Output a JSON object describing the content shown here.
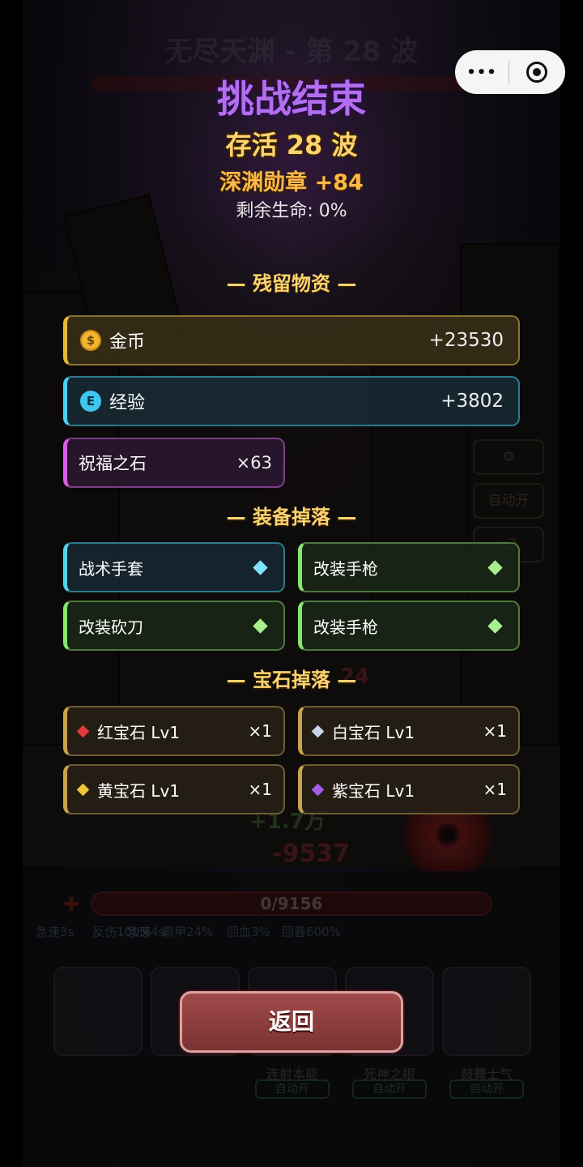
{
  "colors": {
    "title": "#b36ef0",
    "waves": "#ffd36e",
    "medal": "#ffb84a",
    "gold_accent": "#e7b737",
    "exp_accent": "#46d2ee",
    "stone_accent": "#d65ee6",
    "equip_blue_accent": "#53d3ee",
    "equip_green_accent": "#86e56a",
    "gem_accent": "#c9a24d",
    "return_button": "#8e3c3c"
  },
  "background": {
    "stage_title": "无尽天渊 - 第 28 波",
    "hp_bar_text": "0/9156",
    "floating_numbers": [
      "+1.7万",
      "-9537",
      "24"
    ],
    "status_effects": [
      "急速3s",
      "反伤100%",
      "急速4s",
      "霸甲24%",
      "回血3%",
      "回春600%"
    ],
    "skills": [
      {
        "name": "连射本能",
        "auto": "自动开"
      },
      {
        "name": "死神之眼",
        "auto": "自动开"
      },
      {
        "name": "鼓舞士气",
        "auto": "自动开"
      }
    ],
    "side_buttons": {
      "settings_icon": "gear-icon",
      "auto": "自动开",
      "speed": "x3"
    }
  },
  "capsule": {
    "more_icon": "more-dots-icon",
    "close_icon": "target-circle-icon",
    "dots": "•••"
  },
  "result": {
    "title": "挑战结束",
    "survived": "存活 28 波",
    "medal": "深渊勋章 +84",
    "hp_left": "剩余生命: 0%"
  },
  "residual": {
    "section_title": "— 残留物资 —",
    "gold": {
      "icon": "coin-icon",
      "icon_glyph": "$",
      "label": "金币",
      "value": "+23530"
    },
    "exp": {
      "icon": "exp-icon",
      "icon_glyph": "E",
      "label": "经验",
      "value": "+3802"
    },
    "stone": {
      "label": "祝福之石",
      "value": "×63"
    }
  },
  "equipment": {
    "section_title": "— 装备掉落 —",
    "items": [
      {
        "name": "战术手套",
        "rarity": "blue"
      },
      {
        "name": "改装手枪",
        "rarity": "green"
      },
      {
        "name": "改装砍刀",
        "rarity": "green"
      },
      {
        "name": "改装手枪",
        "rarity": "green"
      }
    ]
  },
  "gems": {
    "section_title": "— 宝石掉落 —",
    "items": [
      {
        "name": "红宝石 Lv1",
        "count": "×1",
        "color": "#e23a3a"
      },
      {
        "name": "白宝石 Lv1",
        "count": "×1",
        "color": "#c9d4ea"
      },
      {
        "name": "黄宝石 Lv1",
        "count": "×1",
        "color": "#f1c533"
      },
      {
        "name": "紫宝石 Lv1",
        "count": "×1",
        "color": "#a45de6"
      }
    ]
  },
  "actions": {
    "return_label": "返回"
  }
}
